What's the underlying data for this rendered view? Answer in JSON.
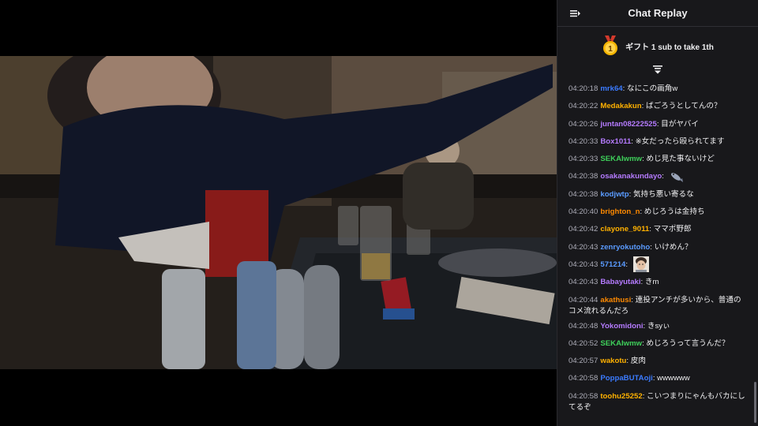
{
  "chat": {
    "title": "Chat Replay",
    "gift_text": "ギフト 1 sub to take 1th",
    "gift_badge_number": "1",
    "messages": [
      {
        "time": "04:20:18",
        "user": "mrk64",
        "color": "#3b7bff",
        "text": "なにこの画角w"
      },
      {
        "time": "04:20:22",
        "user": "Medakakun",
        "color": "#ffb100",
        "text": "ばごろうとしてんの？"
      },
      {
        "time": "04:20:26",
        "user": "juntan08222525",
        "color": "#b57bff",
        "text": "目がヤバイ"
      },
      {
        "time": "04:20:33",
        "user": "Box1011",
        "color": "#b57bff",
        "text": "※女だったら殴られてます"
      },
      {
        "time": "04:20:33",
        "user": "SEKAIwmw",
        "color": "#3ecf5a",
        "text": "めじ見た事ないけど"
      },
      {
        "time": "04:20:38",
        "user": "osakanakundayo",
        "color": "#b57bff",
        "text": "",
        "emote": "fish-emote"
      },
      {
        "time": "04:20:38",
        "user": "kodjwtp",
        "color": "#5a9bff",
        "text": "気持ち悪い寄るな"
      },
      {
        "time": "04:20:40",
        "user": "brighton_n",
        "color": "#ff8a00",
        "text": "めじろうは金持ち"
      },
      {
        "time": "04:20:42",
        "user": "clayone_9011",
        "color": "#ffb100",
        "text": "ママポ野郎"
      },
      {
        "time": "04:20:43",
        "user": "zenryokutoho",
        "color": "#5a9bff",
        "text": "いけめん？"
      },
      {
        "time": "04:20:43",
        "user": "571214",
        "color": "#5a9bff",
        "text": "",
        "emote": "face-emote"
      },
      {
        "time": "04:20:43",
        "user": "Babayutaki",
        "color": "#b57bff",
        "text": "きm"
      },
      {
        "time": "04:20:44",
        "user": "akathusi",
        "color": "#ff8a00",
        "text": "連投アンチが多いから、普通のコメ流れるんだろ",
        "wrap": true
      },
      {
        "time": "04:20:48",
        "user": "Yokomidoni",
        "color": "#b57bff",
        "text": "きsyぃ"
      },
      {
        "time": "04:20:52",
        "user": "SEKAIwmw",
        "color": "#3ecf5a",
        "text": "めじろうって言うんだ？"
      },
      {
        "time": "04:20:57",
        "user": "wakotu",
        "color": "#ffb100",
        "text": "皮肉"
      },
      {
        "time": "04:20:58",
        "user": "PoppaBUTAoji",
        "color": "#3b7bff",
        "text": "wwwwww"
      },
      {
        "time": "04:20:58",
        "user": "toohu25252",
        "color": "#ffb100",
        "text": "こいつまりにゃんもバカにしてるぞ",
        "wrap": true
      }
    ]
  }
}
